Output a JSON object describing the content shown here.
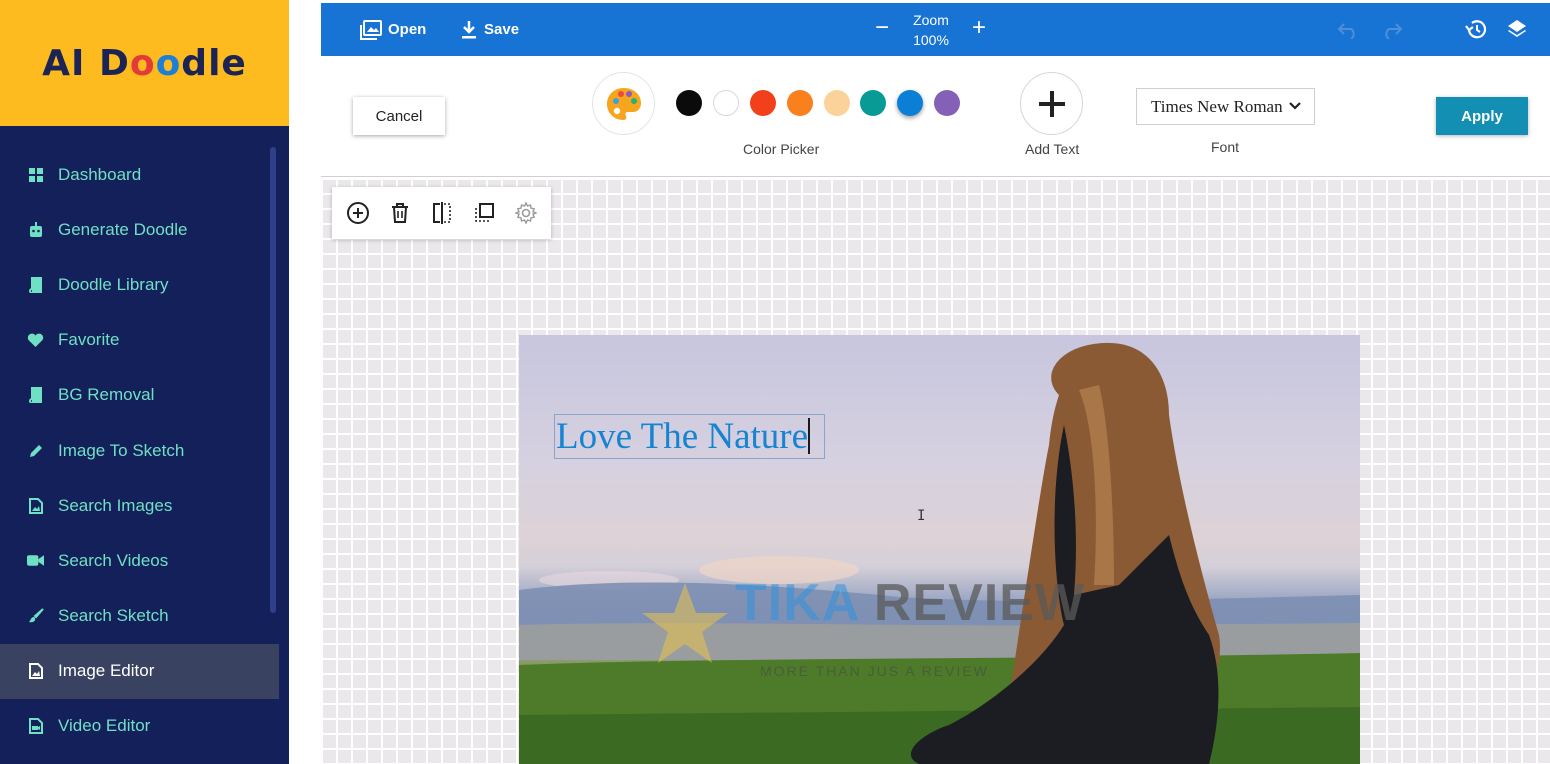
{
  "app": {
    "logo_text": "AI Doodle"
  },
  "sidebar": {
    "items": [
      {
        "label": "Dashboard",
        "icon": "grid-icon",
        "active": false
      },
      {
        "label": "Generate Doodle",
        "icon": "robot-icon",
        "active": false
      },
      {
        "label": "Doodle Library",
        "icon": "book-icon",
        "active": false
      },
      {
        "label": "Favorite",
        "icon": "heart-icon",
        "active": false
      },
      {
        "label": "BG Removal",
        "icon": "book-icon",
        "active": false
      },
      {
        "label": "Image To Sketch",
        "icon": "pencil-icon",
        "active": false
      },
      {
        "label": "Search Images",
        "icon": "image-file-icon",
        "active": false
      },
      {
        "label": "Search Videos",
        "icon": "video-camera-icon",
        "active": false
      },
      {
        "label": "Search Sketch",
        "icon": "brush-icon",
        "active": false
      },
      {
        "label": "Image Editor",
        "icon": "image-file-icon",
        "active": true
      },
      {
        "label": "Video Editor",
        "icon": "video-file-icon",
        "active": false
      }
    ]
  },
  "topbar": {
    "open_label": "Open",
    "save_label": "Save",
    "zoom_label": "Zoom",
    "zoom_value": "100%",
    "zoom_out": "−",
    "zoom_in": "+"
  },
  "editor": {
    "cancel_label": "Cancel",
    "apply_label": "Apply",
    "color_picker_label": "Color Picker",
    "add_text_label": "Add Text",
    "font_label": "Font",
    "font_value": "Times New Roman",
    "swatches": [
      "#0b0b0b",
      "#ffffff",
      "#f2401c",
      "#f9801d",
      "#fbd39a",
      "#089a94",
      "#0b7fd6",
      "#8460b6"
    ],
    "selected_swatch": "#0b7fd6",
    "accent_color": "#1773d4",
    "apply_color": "#128fb2"
  },
  "canvas": {
    "text_content": "Love The Nature",
    "text_color": "#1784d2",
    "watermark_title_a": "TIKA",
    "watermark_title_b": "REVIEW",
    "watermark_tagline": "MORE THAN JUS A REVIEW"
  }
}
